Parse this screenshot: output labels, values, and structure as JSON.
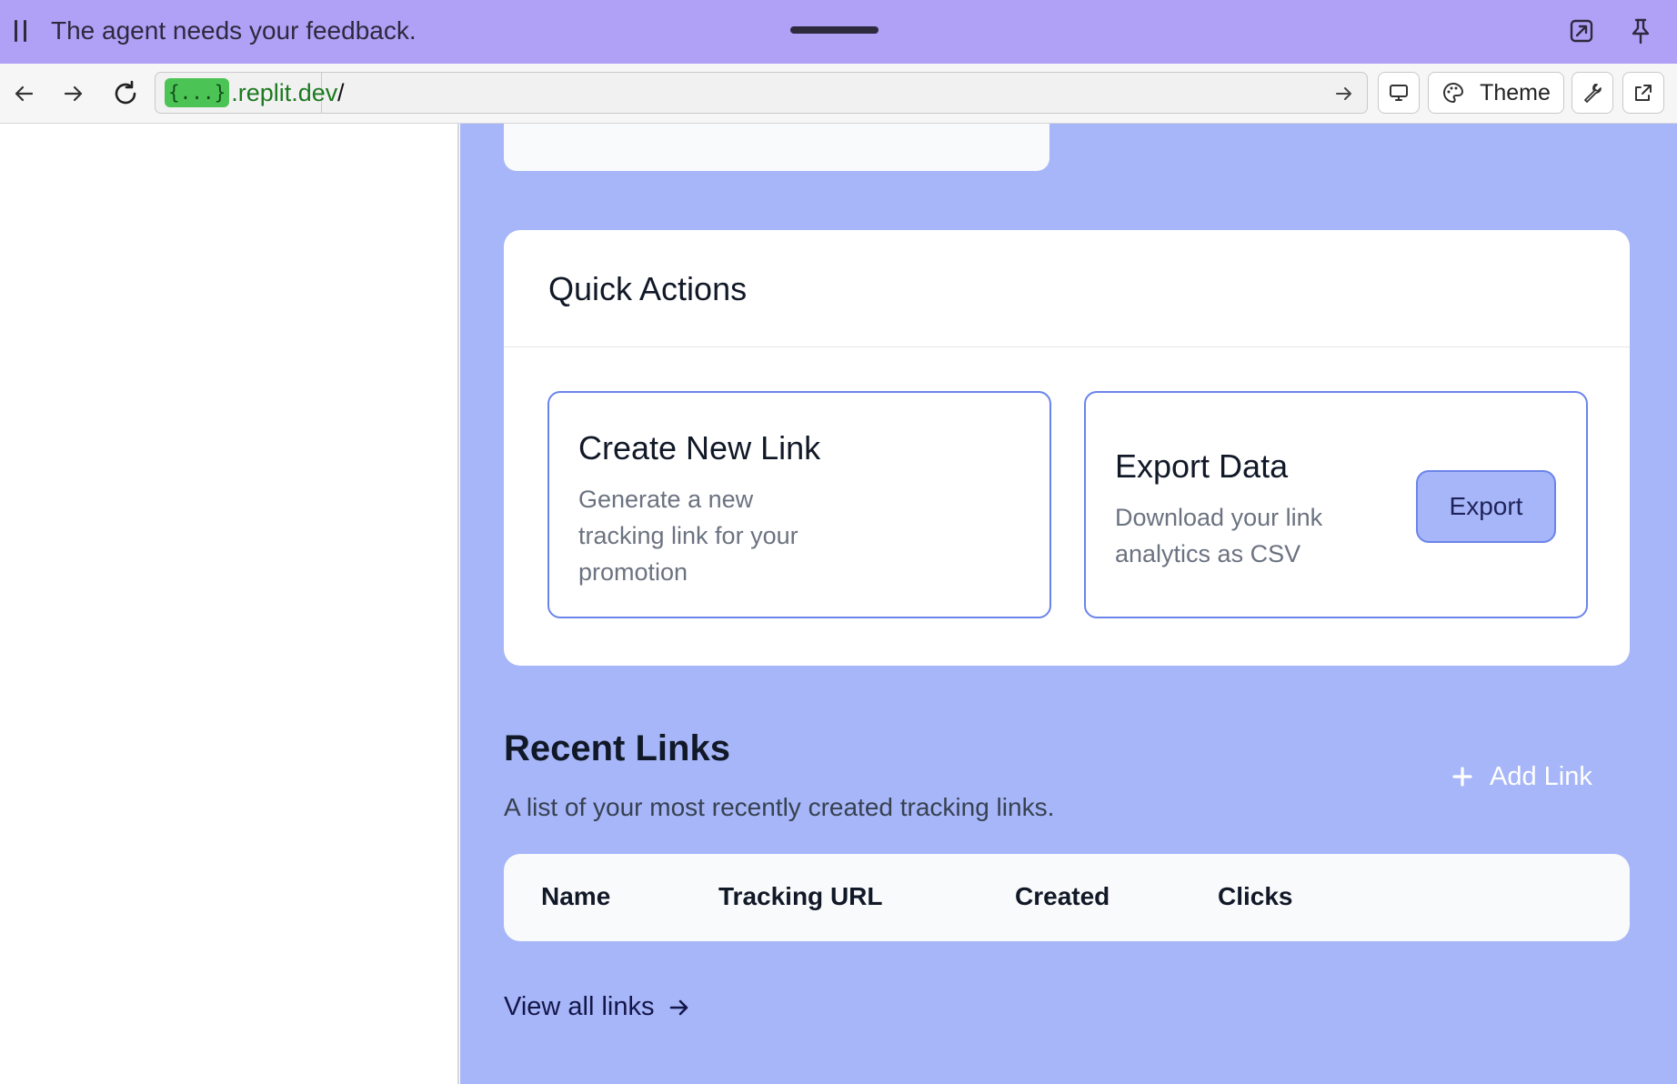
{
  "banner": {
    "message": "The agent needs your feedback."
  },
  "browser": {
    "url_badge": "{...}",
    "url_domain": ".replit.dev",
    "url_path": "/",
    "theme_label": "Theme"
  },
  "quick_actions": {
    "title": "Quick Actions",
    "create": {
      "title": "Create New Link",
      "desc_lines": [
        "Generate a new",
        "tracking link for your",
        "promotion"
      ]
    },
    "export": {
      "title": "Export Data",
      "desc_lines": [
        "Download your link",
        "analytics as CSV"
      ],
      "button_label": "Export"
    }
  },
  "recent_links": {
    "title": "Recent Links",
    "description": "A list of your most recently created tracking links.",
    "add_label": "Add Link",
    "columns": [
      "Name",
      "Tracking URL",
      "Created",
      "Clicks"
    ],
    "view_all_label": "View all links"
  },
  "colors": {
    "banner": "#b0a1f7",
    "page_background": "#a7b6f8",
    "accent_border": "#6b84ea",
    "url_badge": "#4cc455"
  }
}
